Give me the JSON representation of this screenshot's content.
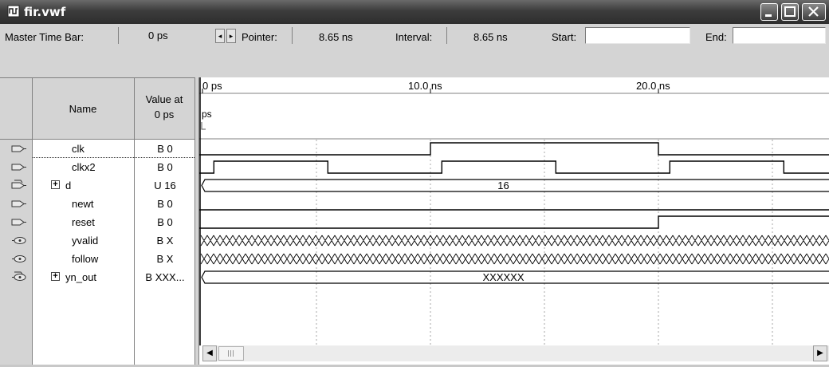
{
  "window": {
    "title": "fir.vwf"
  },
  "toolbar": {
    "master_label": "Master Time Bar:",
    "master_value": "0 ps",
    "pointer_label": "Pointer:",
    "pointer_value": "8.65 ns",
    "interval_label": "Interval:",
    "interval_value": "8.65 ns",
    "start_label": "Start:",
    "start_value": "",
    "end_label": "End:",
    "end_value": ""
  },
  "table": {
    "name_header": "Name",
    "value_header_line1": "Value at",
    "value_header_line2": "0 ps"
  },
  "timeline": {
    "ticks": [
      "0 ps",
      "10.0 ns",
      "20.0 ns"
    ],
    "cursor_label": "ps",
    "d_bus_value": "16",
    "yn_out_bus_value": "XXXXXX"
  },
  "signals": [
    {
      "name": "clk",
      "value": "B 0",
      "kind": "input",
      "expandable": false
    },
    {
      "name": "clkx2",
      "value": "B 0",
      "kind": "input",
      "expandable": false
    },
    {
      "name": "d",
      "value": "U 16",
      "kind": "input-bus",
      "expandable": true
    },
    {
      "name": "newt",
      "value": "B 0",
      "kind": "input",
      "expandable": false
    },
    {
      "name": "reset",
      "value": "B 0",
      "kind": "input",
      "expandable": false
    },
    {
      "name": "yvalid",
      "value": "B X",
      "kind": "output",
      "expandable": false
    },
    {
      "name": "follow",
      "value": "B X",
      "kind": "output",
      "expandable": false
    },
    {
      "name": "yn_out",
      "value": "B XXX...",
      "kind": "output-bus",
      "expandable": true
    }
  ],
  "icons": {
    "app": "waveform-file-icon",
    "input": "input-pin-icon",
    "output": "output-pin-icon",
    "expand": "plus-box-icon",
    "minimize": "minimize-icon",
    "maximize": "maximize-icon",
    "close": "close-icon"
  }
}
